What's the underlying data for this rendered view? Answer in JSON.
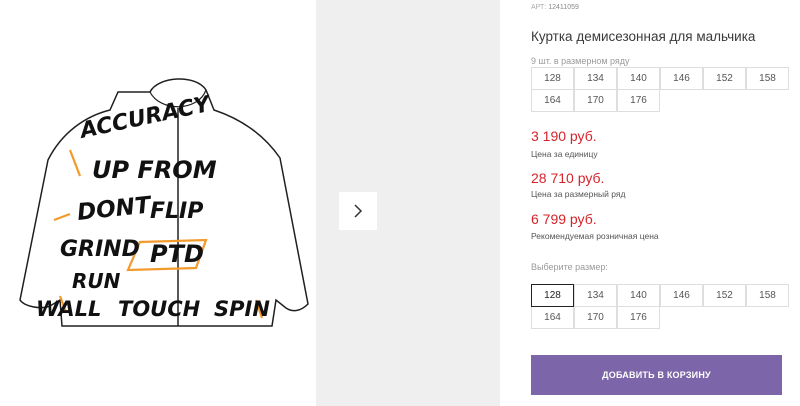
{
  "product": {
    "article_label": "АРТ:",
    "article_value": "12411059",
    "title": "Куртка демисезонная для мальчика",
    "image_print_words": [
      "ACCURACY",
      "FLIP",
      "UP FROM",
      "GRIND",
      "PTD",
      "RUN",
      "TOUCH",
      "SPIN",
      "WALL",
      "DONT"
    ]
  },
  "gallery": {
    "next_icon": "chevron-right-icon"
  },
  "stock": {
    "label": "9 шт. в размерном ряду",
    "sizes": [
      "128",
      "134",
      "140",
      "146",
      "152",
      "158",
      "164",
      "170",
      "176"
    ]
  },
  "prices": [
    {
      "amount": "3 190 руб.",
      "note": "Цена за единицу"
    },
    {
      "amount": "28 710 руб.",
      "note": "Цена за размерный ряд"
    },
    {
      "amount": "6 799 руб.",
      "note": "Рекомендуемая розничная цена"
    }
  ],
  "size_select": {
    "label": "Выберите размер:",
    "selected": "128",
    "sizes": [
      "128",
      "134",
      "140",
      "146",
      "152",
      "158",
      "164",
      "170",
      "176"
    ]
  },
  "cart": {
    "button_label": "ДОБАВИТЬ В КОРЗИНУ"
  },
  "colors": {
    "price": "#d6232a",
    "cart_button": "#7c65a8",
    "accent_orange": "#f39a2c"
  }
}
